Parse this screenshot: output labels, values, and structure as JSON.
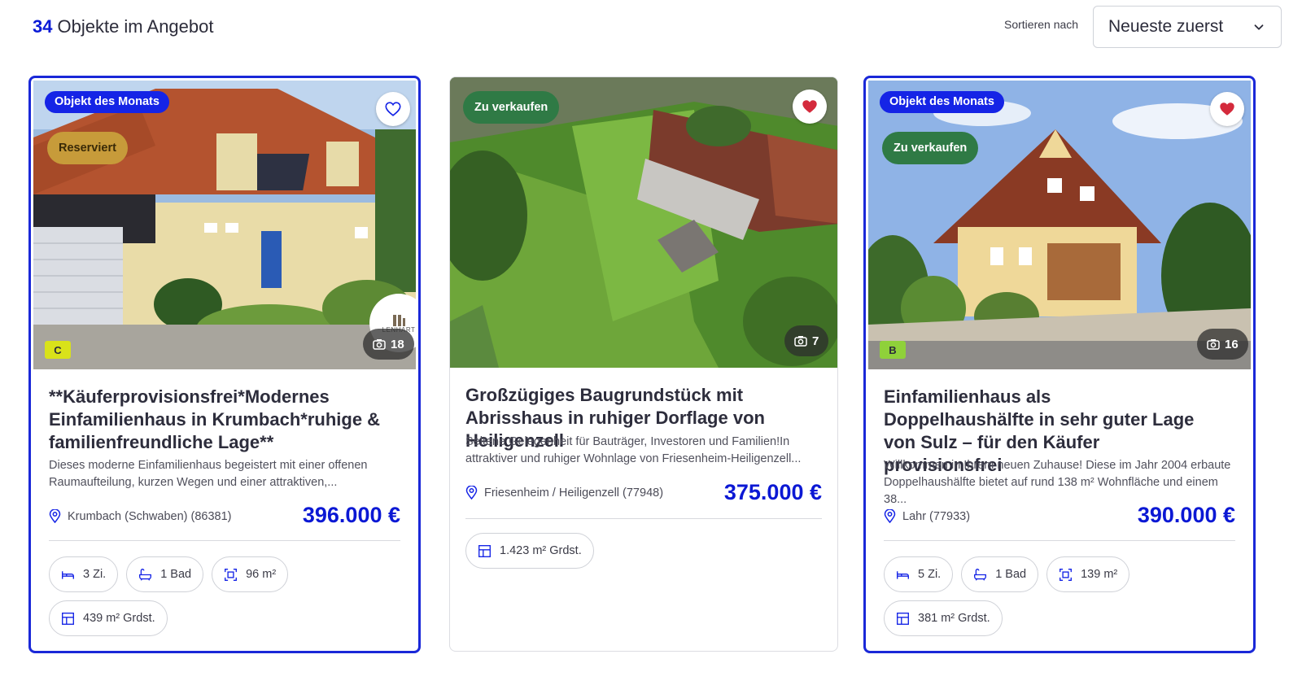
{
  "header": {
    "count": "34",
    "count_label": "Objekte im Angebot",
    "sort_label": "Sortieren nach",
    "sort_value": "Neueste zuerst"
  },
  "colors": {
    "accent": "#1524e6",
    "price": "#0b18d4",
    "sale_badge": "#2f7a45",
    "reserved_badge": "#c79b3a"
  },
  "listings": [
    {
      "badge_month": "Objekt des Monats",
      "badge_status": "Reserviert",
      "favorite": false,
      "energy_class": "C",
      "photo_count": "18",
      "logo_text": "LENHART",
      "title": "**Käuferprovisionsfrei*Modernes Einfamilienhaus in Krumbach*ruhige & familienfreundliche Lage**",
      "description": "Dieses moderne Einfamilienhaus begeistert mit einer offenen Raumaufteilung, kurzen Wegen und einer attraktiven,...",
      "location": "Krumbach (Schwaben) (86381)",
      "price": "396.000 €",
      "rooms": "3 Zi.",
      "baths": "1 Bad",
      "living_area": "96 m²",
      "plot_area": "439 m² Grdst."
    },
    {
      "badge_status": "Zu verkaufen",
      "favorite": true,
      "photo_count": "7",
      "title": "Großzügiges Baugrundstück mit Abrisshaus in ruhiger Dorflage von Heiligenzell",
      "description": "Seltene Gelegenheit für Bauträger, Investoren und Familien!In attraktiver und ruhiger Wohnlage von Friesenheim-Heiligenzell...",
      "location": "Friesenheim / Heiligenzell (77948)",
      "price": "375.000 €",
      "plot_area": "1.423 m² Grdst."
    },
    {
      "badge_month": "Objekt des Monats",
      "badge_status": "Zu verkaufen",
      "favorite": true,
      "energy_class": "B",
      "photo_count": "16",
      "title": "Einfamilienhaus als Doppelhaushälfte in sehr guter Lage von Sulz – für den Käufer provisionsfrei",
      "description": "Willkommen in Ihrem neuen Zuhause! Diese im Jahr 2004 erbaute Doppelhaushälfte bietet auf rund 138 m² Wohnfläche und einem 38...",
      "location": "Lahr (77933)",
      "price": "390.000 €",
      "rooms": "5 Zi.",
      "baths": "1 Bad",
      "living_area": "139 m²",
      "plot_area": "381 m² Grdst."
    }
  ]
}
